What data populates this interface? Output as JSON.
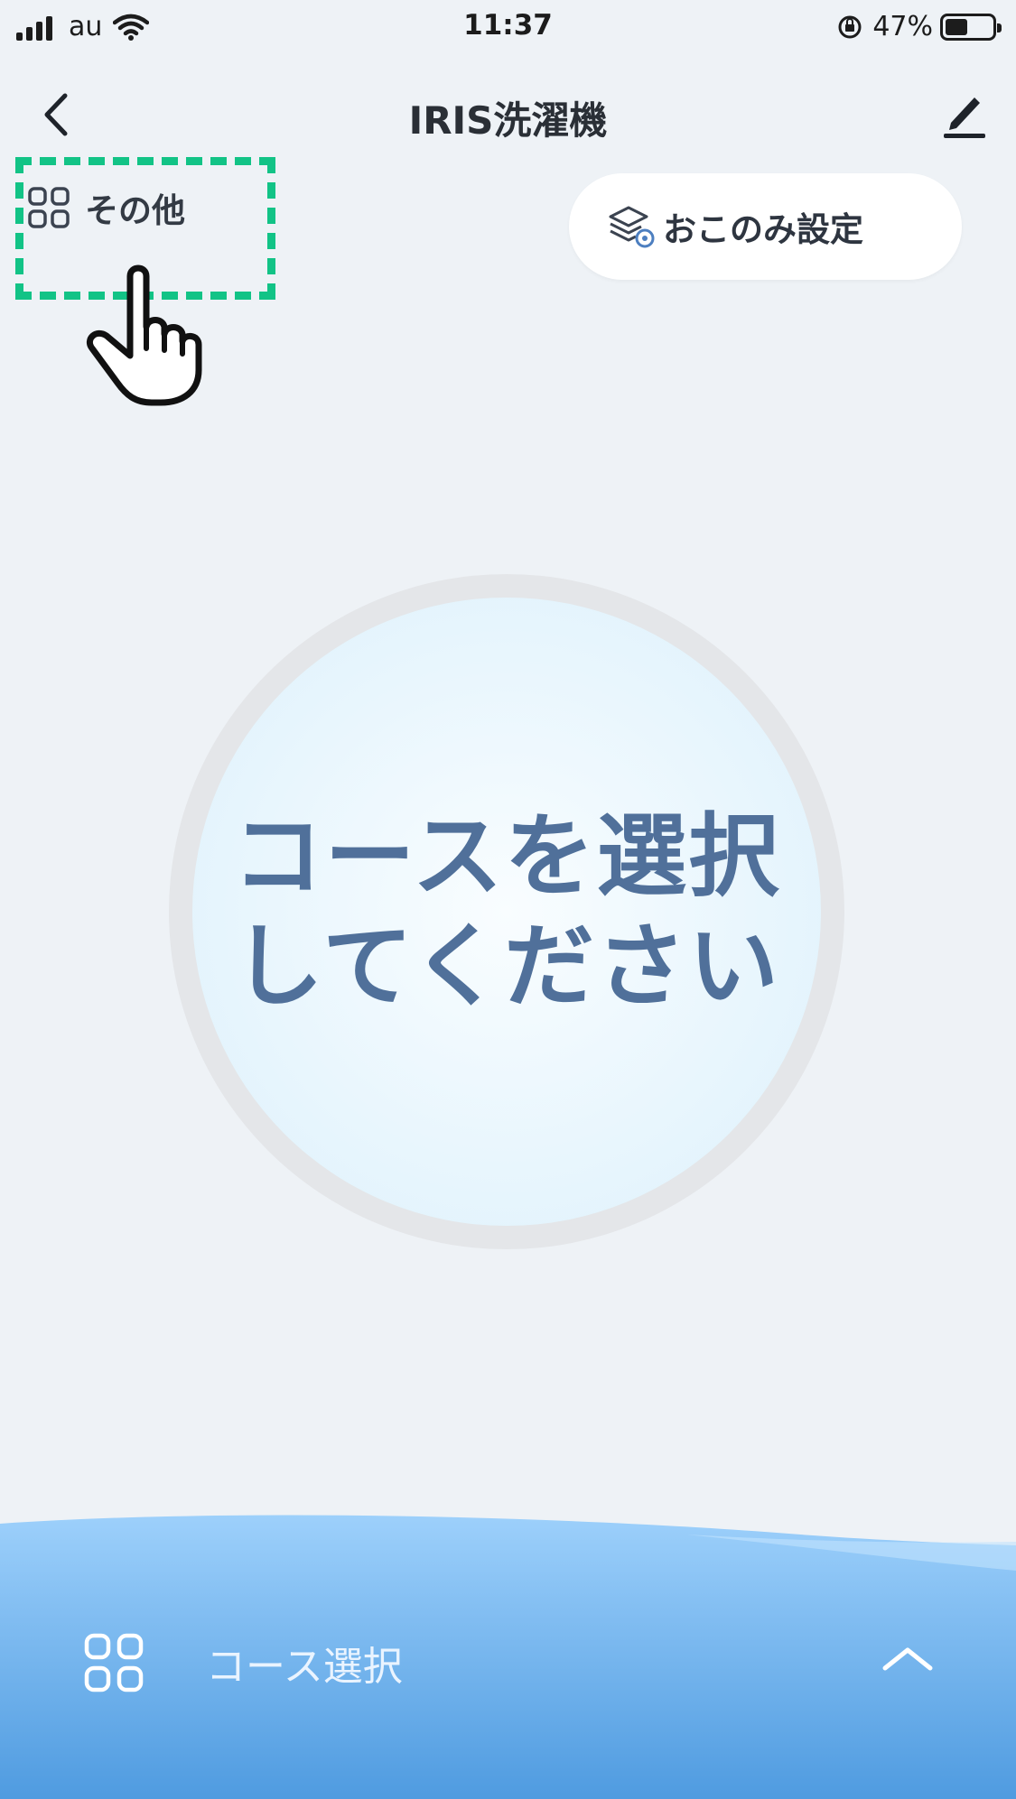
{
  "status_bar": {
    "carrier": "au",
    "time": "11:37",
    "battery_percent_text": "47%",
    "battery_level": 0.47
  },
  "nav": {
    "title": "IRIS洗濯機"
  },
  "toolbar": {
    "other_label": "その他",
    "preferences_label": "おこのみ設定"
  },
  "dial": {
    "line1": "コースを選択",
    "line2": "してください"
  },
  "bottom": {
    "course_select_label": "コース選択"
  },
  "icons": {
    "back": "chevron-left-icon",
    "edit": "pencil-icon",
    "other": "grid-icon",
    "preferences": "layers-settings-icon",
    "course": "grid-icon",
    "expand": "chevron-up-icon",
    "pointer": "pointing-hand-icon"
  },
  "colors": {
    "highlight": "#12c386",
    "dial_text": "#50709a",
    "bottom_bar": "#5fa8e6",
    "background": "#eef2f6"
  }
}
